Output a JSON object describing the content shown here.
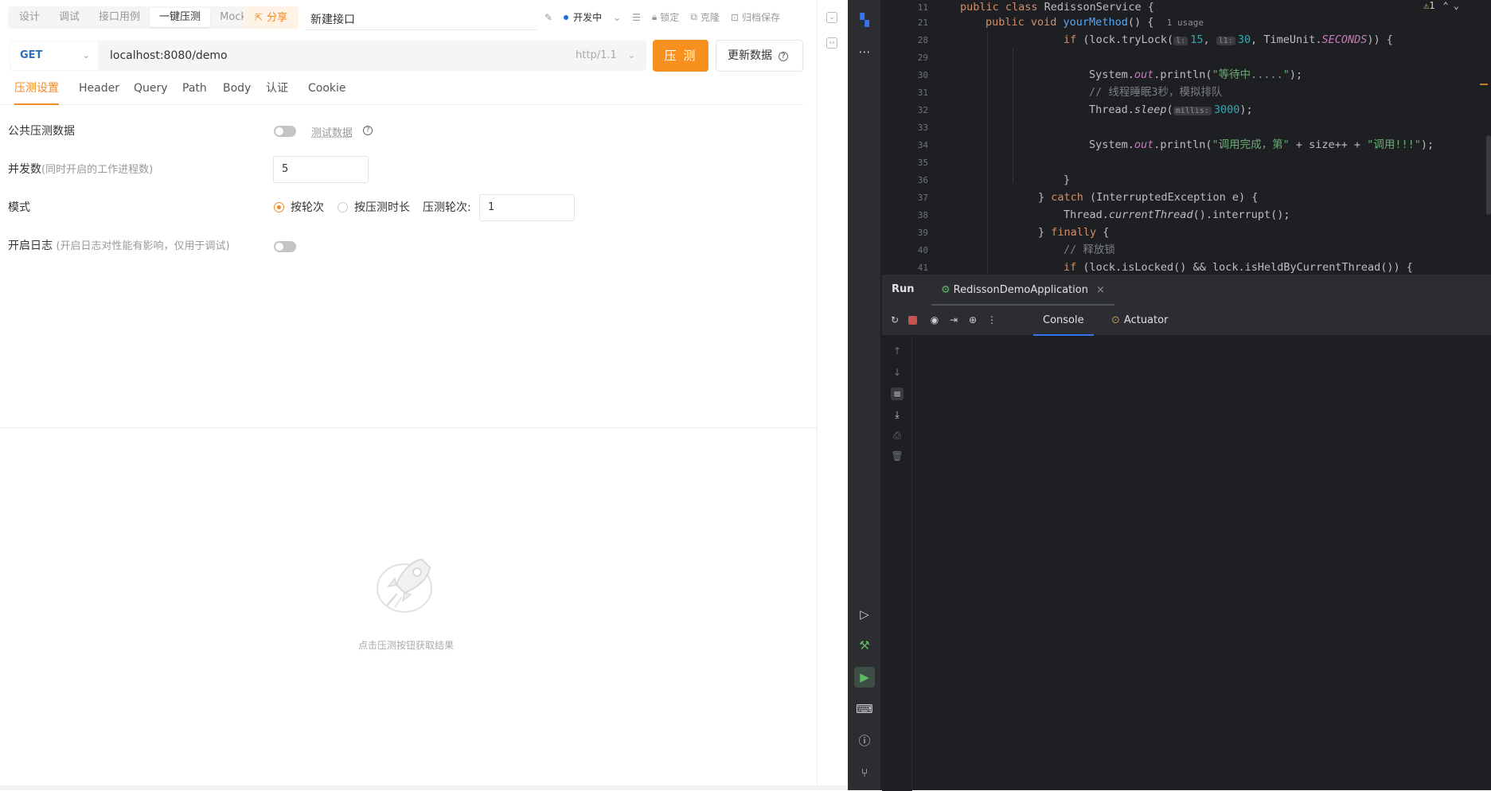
{
  "mode_tabs": [
    "设计",
    "调试",
    "接口用例",
    "一键压测",
    "Mock"
  ],
  "share_label": "分享",
  "api_name": "新建接口",
  "env_label": "开发中",
  "top_actions": [
    "锁定",
    "克隆",
    "归档保存"
  ],
  "request": {
    "method": "GET",
    "url": "localhost:8080/demo",
    "protocol": "http/1.1",
    "run_label": "压 测",
    "update_label": "更新数据"
  },
  "request_tabs": [
    "压测设置",
    "Header",
    "Query",
    "Path",
    "Body",
    "认证",
    "Cookie"
  ],
  "form": {
    "public_data_label": "公共压测数据",
    "test_data_link": "测试数据",
    "concurrency_label": "并发数",
    "concurrency_hint": "(同时开启的工作进程数)",
    "concurrency_value": "5",
    "mode_label": "模式",
    "mode_option_rounds": "按轮次",
    "mode_option_duration": "按压测时长",
    "rounds_label": "压测轮次:",
    "rounds_value": "1",
    "log_label": "开启日志",
    "log_hint": "(开启日志对性能有影响，仅用于调试)"
  },
  "empty_text": "点击压测按钮获取结果",
  "ide": {
    "warning_count": "1",
    "line_numbers": [
      "11",
      "21",
      "28",
      "29",
      "30",
      "31",
      "32",
      "33",
      "34",
      "35",
      "36",
      "37",
      "38",
      "39",
      "40",
      "41"
    ],
    "code": {
      "l11_kw": "public class",
      "l11_name": " RedissonService {",
      "l21_kw": "public void",
      "l21_fn": "yourMethod",
      "l21_rest": "() {",
      "l21_usage": "1 usage",
      "l28_kw": "if",
      "l28_a": " (lock.tryLock(",
      "l28_h1": "l:",
      "l28_n1": "15",
      "l28_b": ", ",
      "l28_h2": "l1:",
      "l28_n2": "30",
      "l28_c": ", TimeUnit.",
      "l28_d": "SECONDS",
      "l28_e": ")) {",
      "l30_a": "System.",
      "l30_out": "out",
      "l30_b": ".println(",
      "l30_str": "\"等待中.....\"",
      "l30_c": ");",
      "l31_cm": "// 线程睡眠3秒，模拟排队",
      "l32_a": "Thread.",
      "l32_fn": "sleep",
      "l32_b": "(",
      "l32_h": "millis:",
      "l32_n": "3000",
      "l32_c": ");",
      "l34_a": "System.",
      "l34_out": "out",
      "l34_b": ".println(",
      "l34_s1": "\"调用完成，第\"",
      "l34_c": " + size++ + ",
      "l34_s2": "\"调用!!!\"",
      "l34_d": ");",
      "l36": "}",
      "l37_a": "} ",
      "l37_kw": "catch",
      "l37_b": " (InterruptedException e) {",
      "l38_a": "Thread.",
      "l38_fn": "currentThread",
      "l38_b": "().interrupt();",
      "l39_a": "} ",
      "l39_kw": "finally",
      "l39_b": " {",
      "l40_cm": "// 释放锁",
      "l41_kw": "if",
      "l41_a": " (lock.isLocked() && lock.isHeldByCurrentThread()) {"
    },
    "run_title": "Run",
    "run_config": "RedissonDemoApplication",
    "console_tab": "Console",
    "actuator_tab": "Actuator"
  }
}
